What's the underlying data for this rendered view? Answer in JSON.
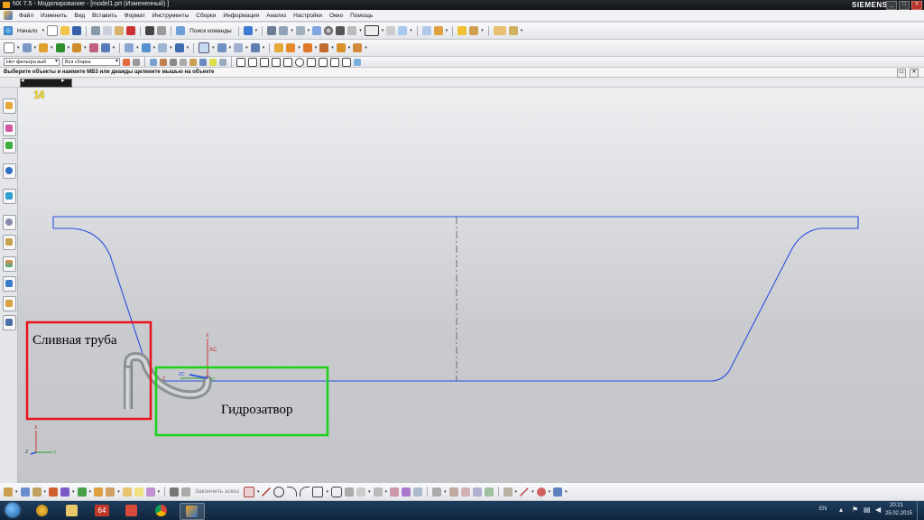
{
  "window": {
    "title": "NX 7.5 - Моделирование - [model1.prt (Измененный) ]",
    "brand": "SIEMENS"
  },
  "menu": [
    "Файл",
    "Изменить",
    "Вид",
    "Вставить",
    "Формат",
    "Инструменты",
    "Сборки",
    "Информация",
    "Анализ",
    "Настройки",
    "Окно",
    "Помощь"
  ],
  "toolbar": {
    "start_label": "Начало",
    "find_command_label": "Поиск команды"
  },
  "filter_bar": {
    "type_filter": "Нет фильтра выб",
    "scope": "Вся сборка"
  },
  "cue_line": "Выберите объекты и нажмите MB3 или дважды щелкните мышью на объекте",
  "view_number": "14",
  "triad": {
    "x": "X",
    "y": "Y",
    "z": "Z",
    "xc": "XC",
    "yc": "YC",
    "zc": "ZC"
  },
  "annotations": {
    "drain_pipe": "Сливная труба",
    "water_seal": "Гидрозатвор",
    "drain_color": "#e8141a",
    "seal_color": "#19d219"
  },
  "sketch_toolbar": {
    "finish_sketch_label": "Закончить эскиз"
  },
  "taskbar": {
    "app_badge": "64",
    "language": "EN",
    "time": "20:21",
    "date": "25.02.2015"
  },
  "colors": {
    "curve_blue": "#2b4fe0",
    "accent_orange": "#f3a31b"
  }
}
